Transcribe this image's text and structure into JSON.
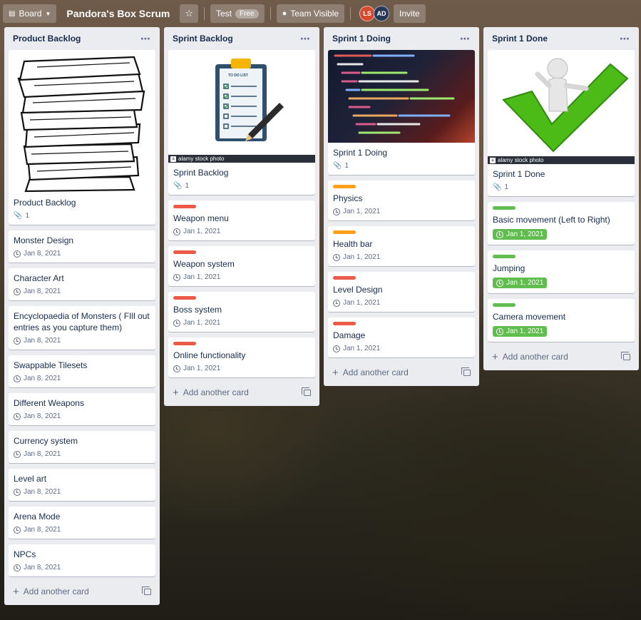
{
  "topbar": {
    "board_label": "Board",
    "board_title": "Pandora's Box Scrum",
    "workspace_label": "Test",
    "workspace_badge": "Free",
    "visibility_label": "Team Visible",
    "invite_label": "Invite",
    "members": [
      "LS",
      "AD"
    ]
  },
  "lists": [
    {
      "title": "Product Backlog",
      "cover_card": {
        "title": "Product Backlog",
        "attachments": "1"
      },
      "cards": [
        {
          "title": "Monster Design",
          "due": "Jan 8, 2021"
        },
        {
          "title": "Character Art",
          "due": "Jan 8, 2021"
        },
        {
          "title": "Encyclopaedia of Monsters ( FIll out entries as you capture them)",
          "due": "Jan 8, 2021"
        },
        {
          "title": "Swappable Tilesets",
          "due": "Jan 8, 2021"
        },
        {
          "title": "Different Weapons",
          "due": "Jan 8, 2021"
        },
        {
          "title": "Currency system",
          "due": "Jan 8, 2021"
        },
        {
          "title": "Level art",
          "due": "Jan 8, 2021"
        },
        {
          "title": "Arena Mode",
          "due": "Jan 8, 2021"
        },
        {
          "title": "NPCs",
          "due": "Jan 8, 2021"
        }
      ],
      "add_label": "Add another card"
    },
    {
      "title": "Sprint Backlog",
      "cover_card": {
        "title": "Sprint Backlog",
        "attachments": "1",
        "image_text": "TO DO LIST",
        "stock_text": "alamy stock photo"
      },
      "cards": [
        {
          "title": "Weapon menu",
          "due": "Jan 1, 2021",
          "label": "red"
        },
        {
          "title": "Weapon system",
          "due": "Jan 1, 2021",
          "label": "red"
        },
        {
          "title": "Boss system",
          "due": "Jan 1, 2021",
          "label": "red"
        },
        {
          "title": "Online functionality",
          "due": "Jan 1, 2021",
          "label": "red"
        }
      ],
      "add_label": "Add another card"
    },
    {
      "title": "Sprint 1 Doing",
      "cover_card": {
        "title": "Sprint 1 Doing",
        "attachments": "1"
      },
      "cards": [
        {
          "title": "Physics",
          "due": "Jan 1, 2021",
          "label": "orange"
        },
        {
          "title": "Health bar",
          "due": "Jan 1, 2021",
          "label": "orange"
        },
        {
          "title": "Level Design",
          "due": "Jan 1, 2021",
          "label": "red"
        },
        {
          "title": "Damage",
          "due": "Jan 1, 2021",
          "label": "red"
        }
      ],
      "add_label": "Add another card"
    },
    {
      "title": "Sprint 1 Done",
      "cover_card": {
        "title": "Sprint 1 Done",
        "attachments": "1",
        "stock_text": "alamy stock photo"
      },
      "cards": [
        {
          "title": "Basic movement (Left to Right)",
          "due": "Jan 1, 2021",
          "label": "green",
          "complete": true
        },
        {
          "title": "Jumping",
          "due": "Jan 1, 2021",
          "label": "green",
          "complete": true
        },
        {
          "title": "Camera movement",
          "due": "Jan 1, 2021",
          "label": "green",
          "complete": true
        }
      ],
      "add_label": "Add another card"
    }
  ],
  "colors": {
    "label_red": "#eb5a46",
    "label_orange": "#ff9f1a",
    "label_green": "#61bd4f"
  }
}
